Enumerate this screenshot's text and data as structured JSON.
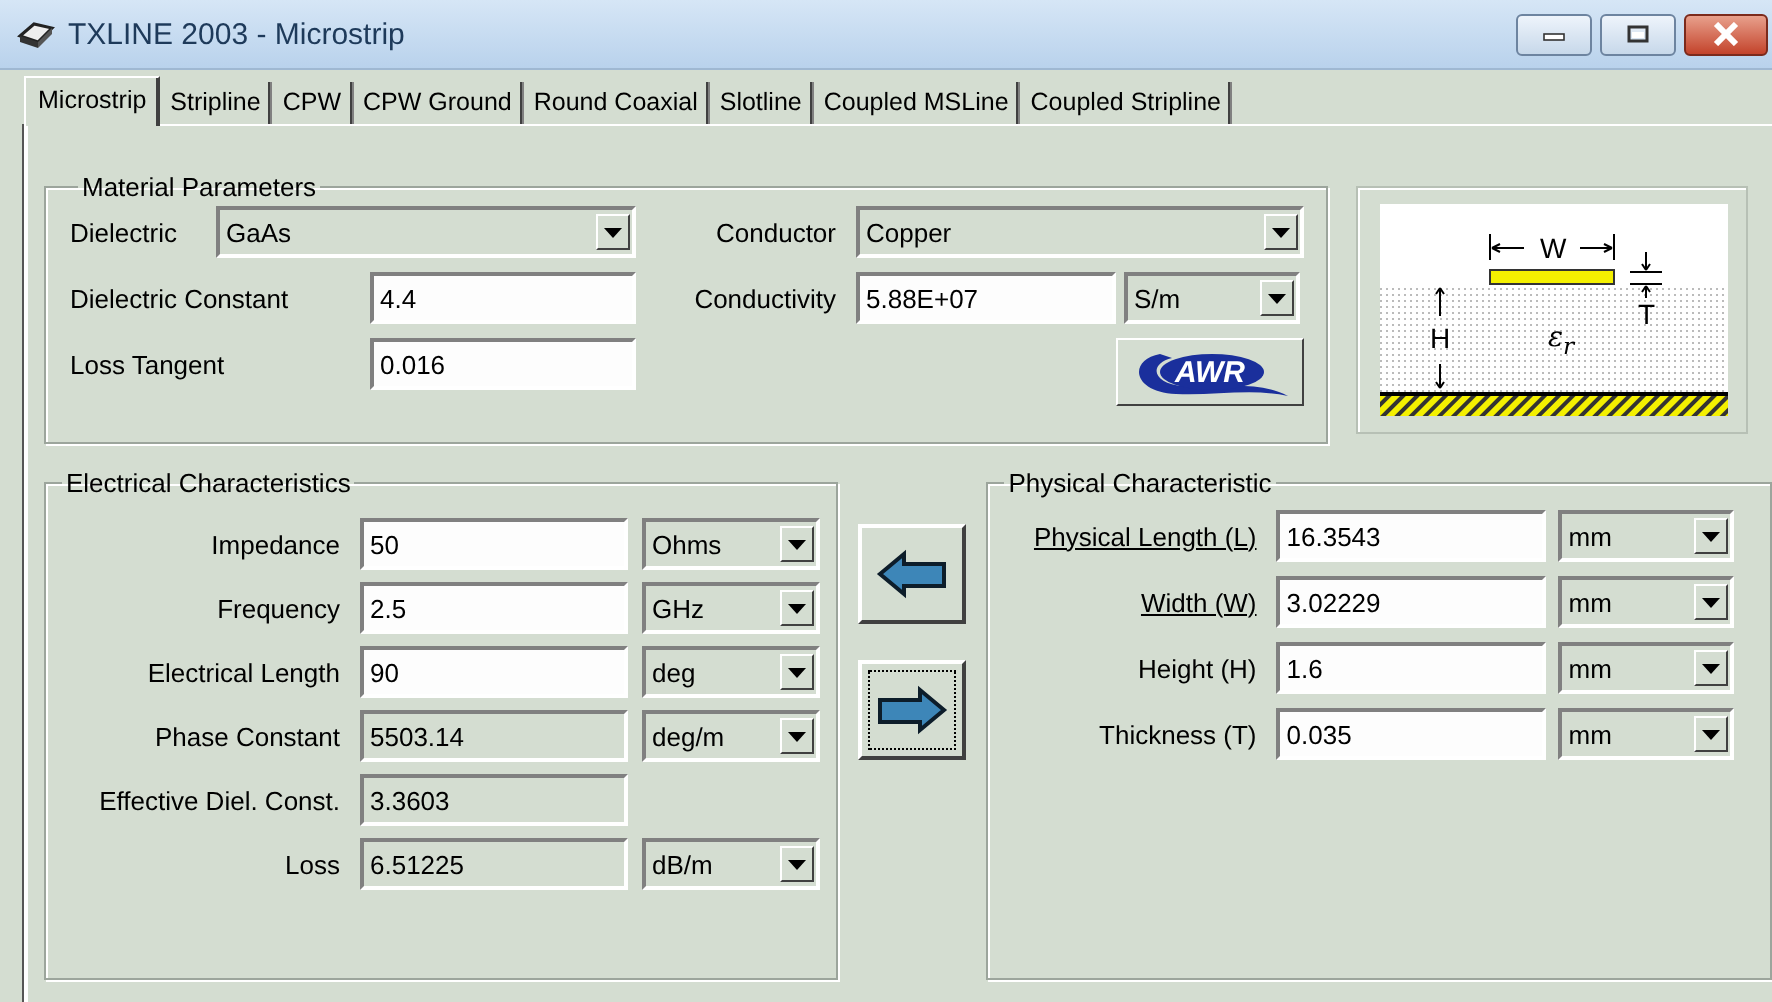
{
  "window": {
    "title": "TXLINE 2003 - Microstrip"
  },
  "tabs": [
    {
      "label": "Microstrip",
      "selected": true
    },
    {
      "label": "Stripline",
      "selected": false
    },
    {
      "label": "CPW",
      "selected": false
    },
    {
      "label": "CPW Ground",
      "selected": false
    },
    {
      "label": "Round Coaxial",
      "selected": false
    },
    {
      "label": "Slotline",
      "selected": false
    },
    {
      "label": "Coupled MSLine",
      "selected": false
    },
    {
      "label": "Coupled Stripline",
      "selected": false
    }
  ],
  "material": {
    "title": "Material Parameters",
    "dielectric": {
      "label": "Dielectric",
      "value": "GaAs"
    },
    "dielectric_constant": {
      "label": "Dielectric Constant",
      "value": "4.4"
    },
    "loss_tangent": {
      "label": "Loss Tangent",
      "value": "0.016"
    },
    "conductor": {
      "label": "Conductor",
      "value": "Copper"
    },
    "conductivity": {
      "label": "Conductivity",
      "value": "5.88E+07",
      "unit": "S/m"
    },
    "logo": {
      "text": "AWR"
    }
  },
  "diagram": {
    "width_label": "W",
    "height_label": "H",
    "thickness_label": "T",
    "permittivity_label": "ε$_{r}$"
  },
  "electrical": {
    "title": "Electrical Characteristics",
    "rows": [
      {
        "label": "Impedance",
        "value": "50",
        "readonly": false,
        "unit": "Ohms"
      },
      {
        "label": "Frequency",
        "value": "2.5",
        "readonly": false,
        "unit": "GHz"
      },
      {
        "label": "Electrical Length",
        "value": "90",
        "readonly": false,
        "unit": "deg"
      },
      {
        "label": "Phase Constant",
        "value": "5503.14",
        "readonly": true,
        "unit": "deg/m"
      },
      {
        "label": "Effective Diel. Const.",
        "value": "3.3603",
        "readonly": true
      },
      {
        "label": "Loss",
        "value": "6.51225",
        "readonly": true,
        "unit": "dB/m"
      }
    ]
  },
  "arrows": [
    {
      "kind": "left",
      "focused": false
    },
    {
      "kind": "right",
      "focused": true
    }
  ],
  "physical": {
    "title": "Physical Characteristic",
    "rows": [
      {
        "label": "Physical Length (L)",
        "underlined": true,
        "value": "16.3543",
        "unit": "mm"
      },
      {
        "label": "Width (W)",
        "underlined": true,
        "value": "3.02229",
        "unit": "mm"
      },
      {
        "label": "Height (H)",
        "underlined": false,
        "value": "1.6",
        "unit": "mm"
      },
      {
        "label": "Thickness (T)",
        "underlined": false,
        "value": "0.035",
        "unit": "mm"
      }
    ]
  }
}
